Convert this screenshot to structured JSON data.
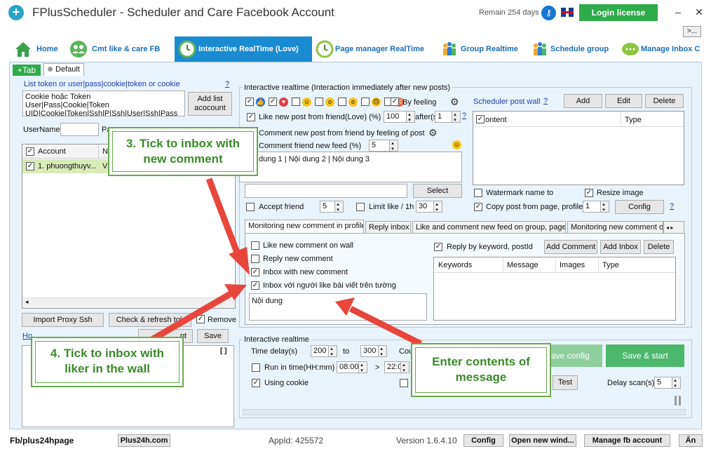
{
  "title": "FPlusScheduler - Scheduler and Care Facebook Account",
  "remain": "Remain 254 days",
  "login_button": "Login license",
  "more_button": ">...",
  "nav_tabs": [
    "Home",
    "Cmt like & care FB",
    "Interactive RealTime (Love)",
    "Page manager RealTime",
    "Group Realtime",
    "Schedule group",
    "Manage Inbox C"
  ],
  "subtabs": {
    "plus": "+Tab",
    "default": "Default"
  },
  "left": {
    "list_label": "List token or user|pass|cookie|token or cookie",
    "list_help": "?",
    "list_lines": [
      "Cookie hoặc Token",
      "User|Pass|Cookie|Token",
      "UID|Cookie|Token|Ssh|P|Ssh|User|Ssh|Pass"
    ],
    "add_list_button": "Add list acocount",
    "username_label": "UserName",
    "pass_label": "Pa",
    "account_col": "Account",
    "second_col": "N",
    "account_row": "1. phuongthuyv...",
    "account_row_v": "V",
    "import_proxy": "Import Proxy Ssh",
    "check_refresh": "Check & refresh tok",
    "remove": "Remove",
    "save": "Save",
    "nt_button": "nt",
    "log_link": "Ho",
    "log_brackets": "[ ]"
  },
  "interactive": {
    "group_title": "Interactive realtime (Interaction immediately after new posts)",
    "by_feeling": "By feeling",
    "like_new_post": "Like new post from friend(Love) (%)",
    "like_value": "100",
    "after_label": "after(s",
    "after_value": "1",
    "help": "?",
    "comment_feeling": "Comment new post from friend by feeling of post",
    "comment_feed": "Comment friend new feed (%)",
    "comment_value": "5",
    "comment_content": "dung 1 | Nội dung 2 | Nội dung 3",
    "select_button": "Select",
    "accept_friend": "Accept friend",
    "accept_value": "5",
    "limit_like": "Limit like / 1h",
    "limit_value": "30"
  },
  "scheduler": {
    "label": "Scheduler post wall",
    "help": "?",
    "add": "Add",
    "edit": "Edit",
    "delete": "Delete",
    "col_content": "ontent",
    "col_type": "Type",
    "watermark": "Watermark name to",
    "resize": "Resize image",
    "copy_post": "Copy post from page, profile,",
    "copy_value": "1",
    "config": "Config",
    "help2": "?"
  },
  "tabs_mid": [
    "Monitoring new comment in profile",
    "Reply inbox",
    "Like and comment new feed on group, page",
    "Monitoring new comment or"
  ],
  "monitoring": {
    "like_new_comment": "Like new comment on wall",
    "reply_new_comment": "Reply new comment",
    "inbox_new_comment": "Inbox with new comment",
    "inbox_liker": "Inbox với người like bài viết trên tường",
    "message_content": "Nội dung",
    "reply_keyword": "Reply by keyword, postId",
    "add_comment": "Add Comment",
    "add_inbox": "Add Inbox",
    "delete": "Delete",
    "col_keywords": "Keywords",
    "col_message": "Message",
    "col_images": "Images",
    "col_type": "Type"
  },
  "realtime": {
    "group_title": "Interactive realtime",
    "time_delay": "Time delay(s)",
    "delay_from": "200",
    "to": "to",
    "delay_to": "300",
    "cou": "Cou",
    "run_in_time": "Run in time(HH:mm)",
    "time_from": "08:00",
    "gt": ">",
    "time_to": "22:00",
    "using_cookie": "Using cookie",
    "save_config": "ave config",
    "save_start": "Save & start",
    "test": "Test",
    "delay_scan": "Delay scan(s)",
    "delay_scan_value": "5"
  },
  "callouts": {
    "c3": [
      "3. Tick to inbox with",
      "new comment"
    ],
    "c4": [
      "4. Tick to inbox with",
      "liker in the wall"
    ],
    "c5": [
      "Enter contents of",
      "message"
    ]
  },
  "statusbar": {
    "fb": "Fb/plus24hpage",
    "site": "Plus24h.com",
    "appid": "AppId: 425572",
    "version": "Version 1.6.4.10",
    "config": "Config",
    "open_new": "Open new wind...",
    "manage_fb": "Manage fb account",
    "an": "Ẩn"
  },
  "colors": {
    "accent": "#1a8bd0",
    "green": "#2eab4a",
    "arrow": "#e8463c",
    "callout_text": "#3a8a2a"
  }
}
